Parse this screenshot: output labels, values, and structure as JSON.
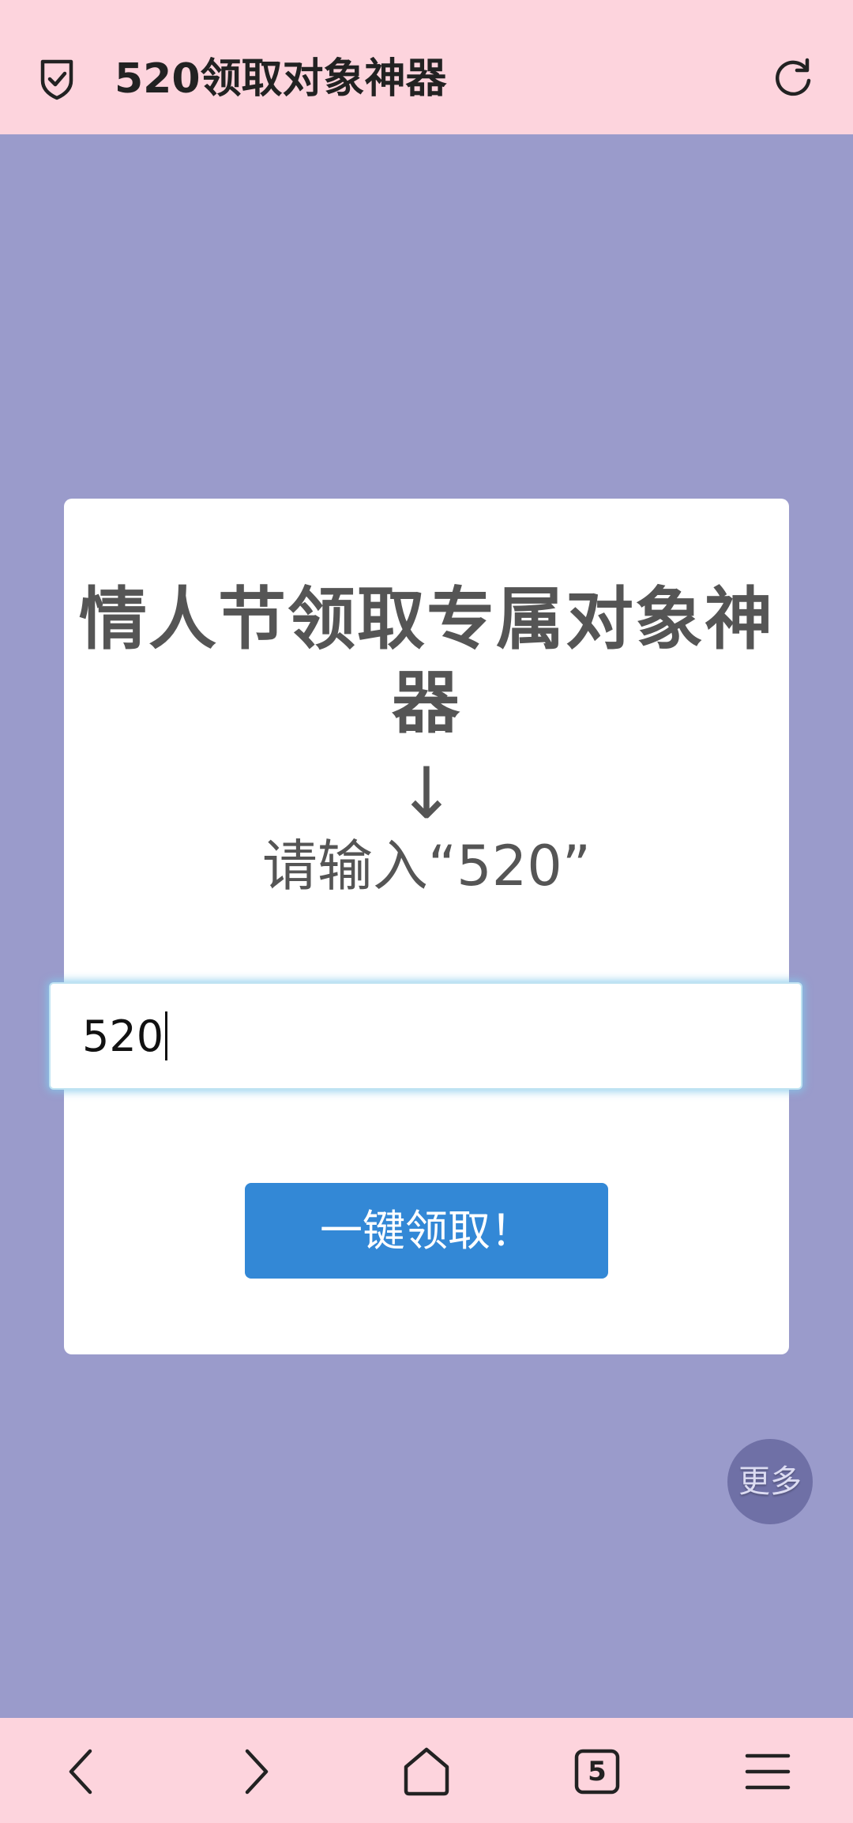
{
  "header": {
    "title": "520领取对象神器",
    "shield_icon": "shield-check-icon",
    "refresh_icon": "refresh-icon"
  },
  "card": {
    "title": "情人节领取专属对象神器",
    "arrow": "↓",
    "prompt": "请输入“520”"
  },
  "input": {
    "value": "520"
  },
  "button": {
    "label": "一键领取！"
  },
  "floating": {
    "more_label": "更多"
  },
  "bottom_nav": {
    "tab_count": "5",
    "items": [
      "back-icon",
      "forward-icon",
      "home-icon",
      "tabs-icon",
      "menu-icon"
    ]
  },
  "colors": {
    "header_bg": "#fdd4dd",
    "page_bg": "#9a9bcb",
    "button_bg": "#3388d6",
    "more_bg": "#6f70a6"
  }
}
